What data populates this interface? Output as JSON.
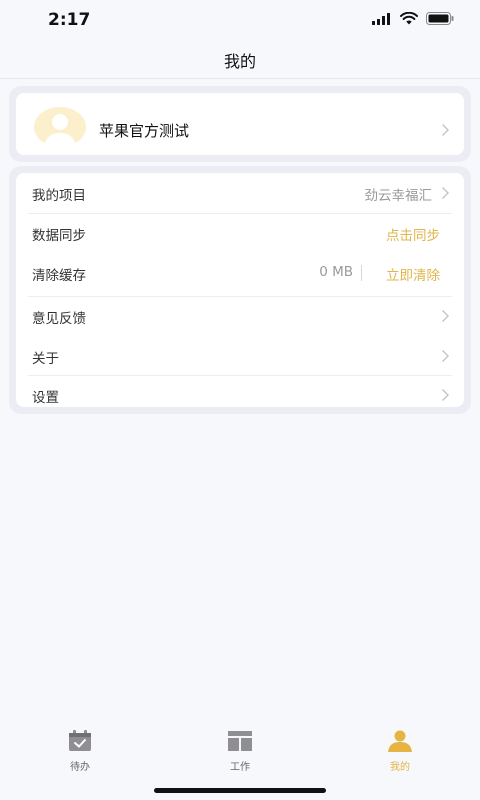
{
  "status_bar": {
    "time": "2:17"
  },
  "header": {
    "title": "我的"
  },
  "profile": {
    "name": "苹果官方测试"
  },
  "menu": {
    "my_project": {
      "label": "我的项目",
      "value": "劲云幸福汇"
    },
    "data_sync": {
      "label": "数据同步",
      "action": "点击同步"
    },
    "clear_cache": {
      "label": "清除缓存",
      "size": "0 MB",
      "action": "立即清除"
    },
    "feedback": {
      "label": "意见反馈"
    },
    "about": {
      "label": "关于"
    },
    "settings": {
      "label": "设置"
    }
  },
  "tab_bar": {
    "items": [
      {
        "label": "待办",
        "icon": "calendar-check-icon"
      },
      {
        "label": "工作",
        "icon": "layout-icon"
      },
      {
        "label": "我的",
        "icon": "person-icon"
      }
    ],
    "active": 2,
    "active_color": "#E5B442"
  },
  "colors": {
    "accent": "#E0B54C",
    "background": "#F7F8FC"
  }
}
